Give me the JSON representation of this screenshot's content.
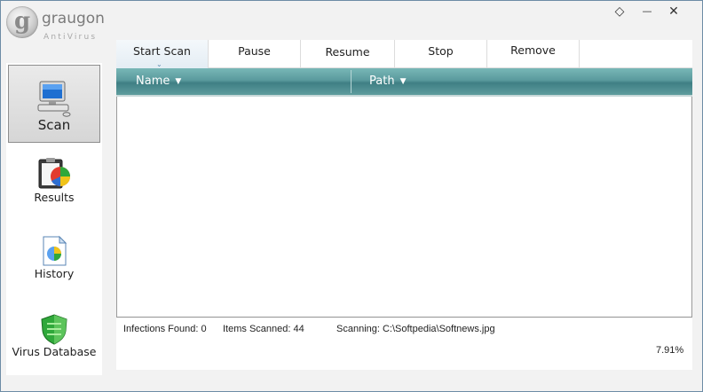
{
  "app": {
    "name": "graugon",
    "subtitle": "AntiVirus"
  },
  "window_controls": {
    "restore_glyph": "◇",
    "minimize_glyph": "—",
    "close_glyph": "✕"
  },
  "sidebar": {
    "items": [
      {
        "label": "Scan",
        "icon": "monitor-icon",
        "active": true
      },
      {
        "label": "Results",
        "icon": "clipboard-chart-icon",
        "active": false
      },
      {
        "label": "History",
        "icon": "document-chart-icon",
        "active": false
      },
      {
        "label": "Virus Database",
        "icon": "shield-icon",
        "active": false
      }
    ]
  },
  "toolbar": {
    "buttons": [
      {
        "label": "Start Scan"
      },
      {
        "label": "Pause"
      },
      {
        "label": "Resume"
      },
      {
        "label": "Stop"
      },
      {
        "label": "Remove"
      }
    ],
    "caret_glyph": "⌄"
  },
  "table": {
    "columns": [
      {
        "label": "Name"
      },
      {
        "label": "Path"
      }
    ],
    "sort_glyph": "▼",
    "rows": []
  },
  "status": {
    "infections": "Infections Found: 0",
    "items_scanned": "Items Scanned: 44",
    "scanning": "Scanning: C:\\Softpedia\\Softnews.jpg",
    "progress": "7.91%"
  },
  "colors": {
    "header_teal": "#5a9a9d",
    "window_border": "#6d8ca6",
    "accent_blue": "#1f6fd1",
    "shield_green": "#2fa83a"
  }
}
